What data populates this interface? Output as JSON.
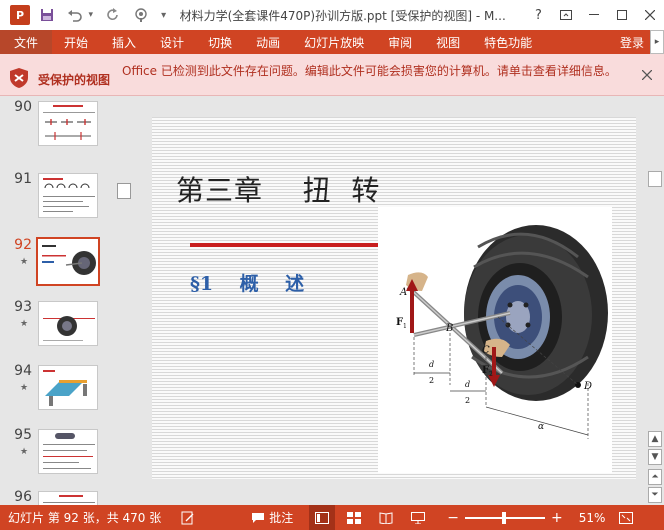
{
  "titlebar": {
    "app_icon_label": "P",
    "title": "材料力学(全套课件470P)孙训方版.ppt [受保护的视图] - M...",
    "help_label": "?",
    "icons": [
      "save-icon",
      "undo-icon",
      "redo-icon",
      "touch-mode-icon",
      "customize-icon"
    ]
  },
  "ribbon": {
    "tabs": [
      "文件",
      "开始",
      "插入",
      "设计",
      "切换",
      "动画",
      "幻灯片放映",
      "审阅",
      "视图",
      "特色功能"
    ],
    "account_label": "登录"
  },
  "protected_view": {
    "title": "受保护的视图",
    "message": "Office 已检测到此文件存在问题。编辑此文件可能会损害您的计算机。请单击查看详细信息。"
  },
  "thumbnails": [
    {
      "number": "90",
      "star": false,
      "selected": false
    },
    {
      "number": "91",
      "star": false,
      "selected": false
    },
    {
      "number": "92",
      "star": true,
      "selected": true
    },
    {
      "number": "93",
      "star": true,
      "selected": false
    },
    {
      "number": "94",
      "star": true,
      "selected": false
    },
    {
      "number": "95",
      "star": true,
      "selected": false
    },
    {
      "number": "96",
      "star": true,
      "selected": false
    }
  ],
  "slide": {
    "title": "第三章    扭  转",
    "subtitle": "§1    概    述",
    "diagram_labels": {
      "a": "A",
      "f1": "F",
      "f1_sub": "1",
      "b": "B",
      "c": "C",
      "f2": "F",
      "f2_sub": "2",
      "d": "D",
      "half1": "d",
      "half1_den": "2",
      "half2": "d",
      "half2_den": "2",
      "alpha": "α"
    }
  },
  "status": {
    "slide_info": "幻灯片 第 92 张，共 470 张",
    "comments_label": "批注",
    "zoom_percent": "51%",
    "zoom_level": 0.51
  },
  "colors": {
    "accent": "#d04423",
    "protected_bg": "#f9dcdc",
    "subtitle": "#2d5fa8"
  }
}
